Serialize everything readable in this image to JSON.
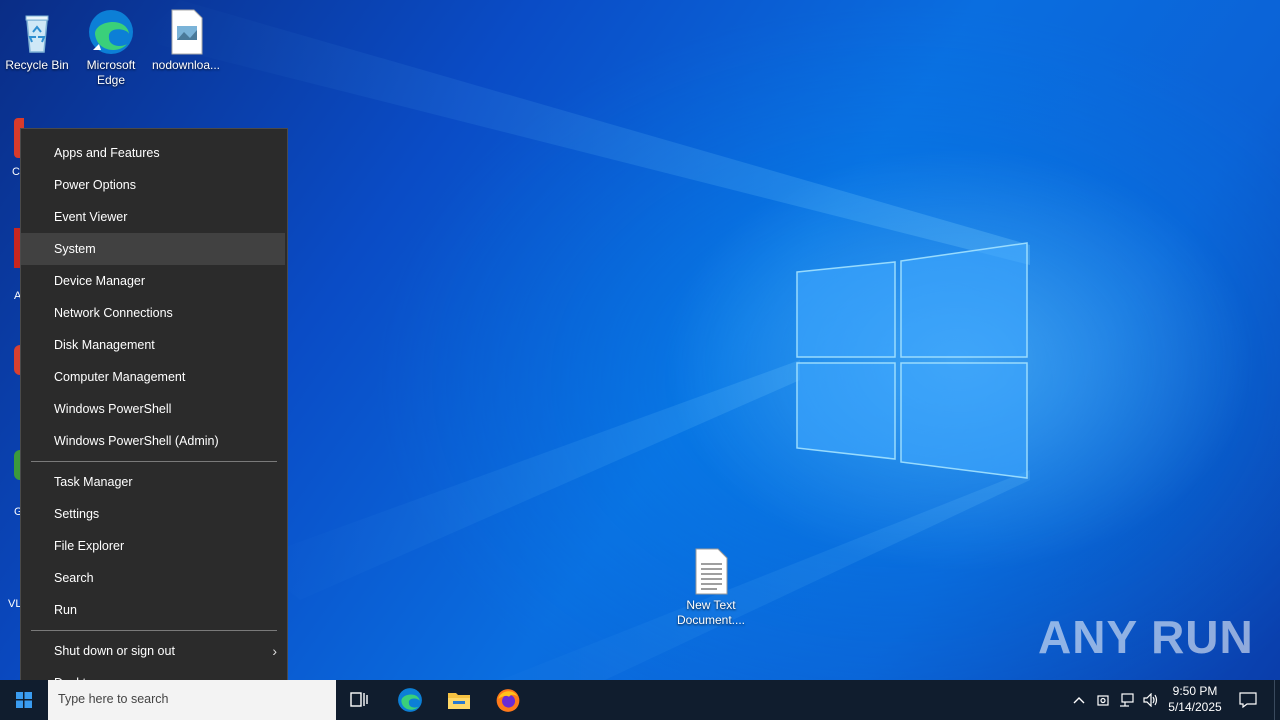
{
  "desktop": {
    "icons": [
      {
        "label": "Recycle Bin"
      },
      {
        "label": "Microsoft Edge"
      },
      {
        "label": "nodownloa..."
      },
      {
        "label": "New Text Document...."
      }
    ],
    "partial_labels": [
      "C",
      "A",
      "G",
      "VL"
    ],
    "watermark": "ANY RUN"
  },
  "winx_menu": {
    "group1": [
      "Apps and Features",
      "Power Options",
      "Event Viewer",
      "System",
      "Device Manager",
      "Network Connections",
      "Disk Management",
      "Computer Management",
      "Windows PowerShell",
      "Windows PowerShell (Admin)"
    ],
    "group2": [
      "Task Manager",
      "Settings",
      "File Explorer",
      "Search",
      "Run"
    ],
    "group3": [
      "Shut down or sign out",
      "Desktop"
    ],
    "highlighted": "System"
  },
  "taskbar": {
    "search_placeholder": "Type here to search",
    "pinned": [
      "task-view-icon",
      "edge-icon",
      "file-explorer-icon",
      "firefox-icon"
    ],
    "tray": [
      "chevron-up-icon",
      "meet-now-icon",
      "network-icon",
      "volume-icon"
    ],
    "time": "9:50 PM",
    "date": "5/14/2025"
  },
  "colors": {
    "menu_bg": "#2b2b2b",
    "menu_highlight": "#414141",
    "taskbar_bg": "#101d2e"
  }
}
